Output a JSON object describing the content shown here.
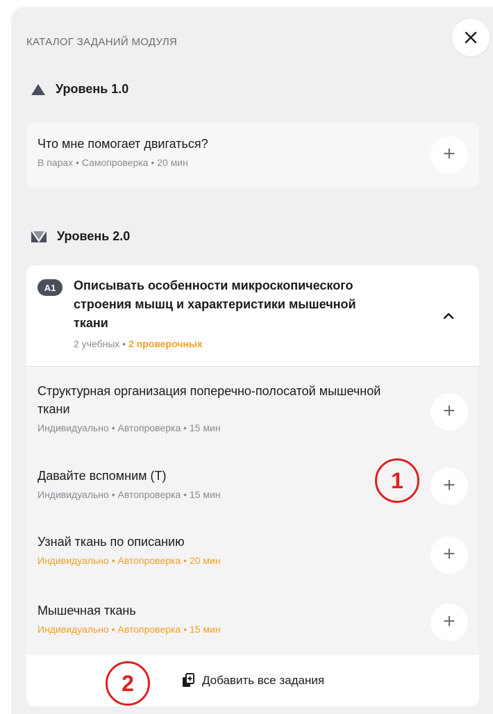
{
  "panel": {
    "title": "КАТАЛОГ ЗАДАНИЙ МОДУЛЯ",
    "close_icon": "close-icon"
  },
  "level1": {
    "label": "Уровень 1.0",
    "icon": "triangle-level-icon",
    "task": {
      "title": "Что мне помогает двигаться?",
      "meta": "В парах • Самопроверка • 20 мин"
    }
  },
  "level2": {
    "label": "Уровень 2.0",
    "icon": "double-triangle-level-icon",
    "objective": {
      "badge": "А1",
      "title": "Описывать особенности микроскопического строения мышц и характеристики мышечной ткани",
      "meta_learning": "2 учебных",
      "meta_separator": " • ",
      "meta_check": "2 проверочных"
    },
    "tasks": [
      {
        "title": "Структурная организация поперечно-полосатой мышечной ткани",
        "meta": "Индивидуально • Автопроверка • 15 мин",
        "highlight": false
      },
      {
        "title": "Давайте вспомним (Т)",
        "meta": "Индивидуально • Автопроверка • 15 мин",
        "highlight": false
      },
      {
        "title": "Узнай ткань по описанию",
        "meta": "Индивидуально • Автопроверка • 20 мин",
        "highlight": true
      },
      {
        "title": "Мышечная ткань",
        "meta": "Индивидуально • Автопроверка • 15 мин",
        "highlight": true
      }
    ],
    "add_all_label": "Добавить все задания"
  },
  "annotations": {
    "marker1": "1",
    "marker2": "2"
  },
  "colors": {
    "accent_orange": "#f0a020",
    "marker_red": "#e02020",
    "panel_bg": "#f0f0f2"
  }
}
